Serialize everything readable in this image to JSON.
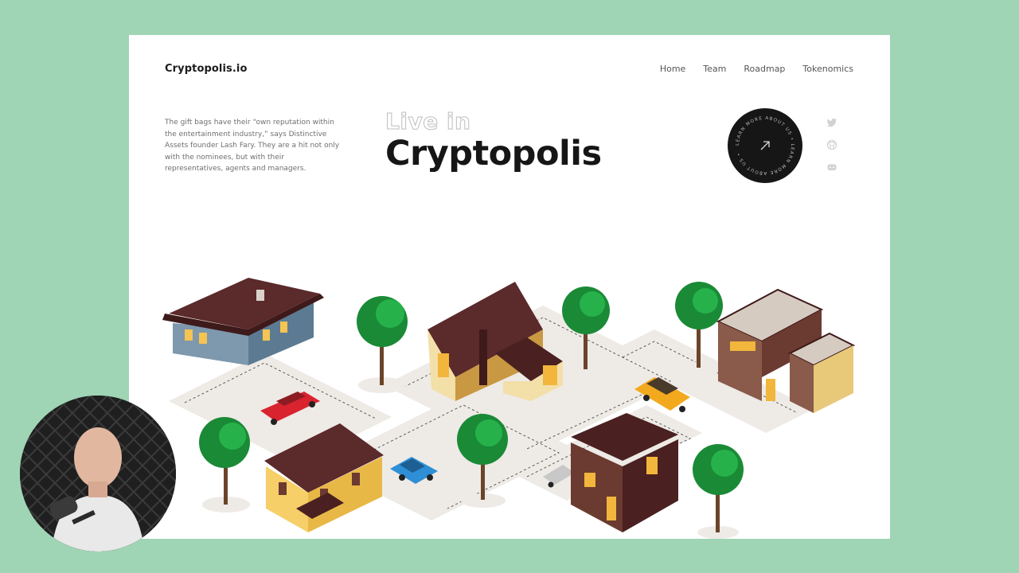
{
  "brand": {
    "name": "Cryptopolis.io"
  },
  "nav": [
    {
      "label": "Home"
    },
    {
      "label": "Team"
    },
    {
      "label": "Roadmap"
    },
    {
      "label": "Tokenomics"
    }
  ],
  "blurb": "The gift bags have their “own reputation within the entertainment industry,” says Distinctive Assets founder Lash Fary. They are a hit not only with the nominees, but with their representatives, agents and managers.",
  "hero": {
    "small": "Live in",
    "big": "Cryptopolis"
  },
  "badge": {
    "ring_text": "LEARN MORE ABOUT US • LEARN MORE ABOUT US •",
    "icon": "arrow-up-right-icon"
  },
  "social": [
    {
      "icon": "twitter-icon"
    },
    {
      "icon": "github-icon"
    },
    {
      "icon": "discord-icon"
    }
  ],
  "colors": {
    "background": "#9fd5b5",
    "page": "#ffffff",
    "text_dark": "#161616",
    "roof": "#5b2a2a",
    "tree": "#1e9b3d"
  }
}
